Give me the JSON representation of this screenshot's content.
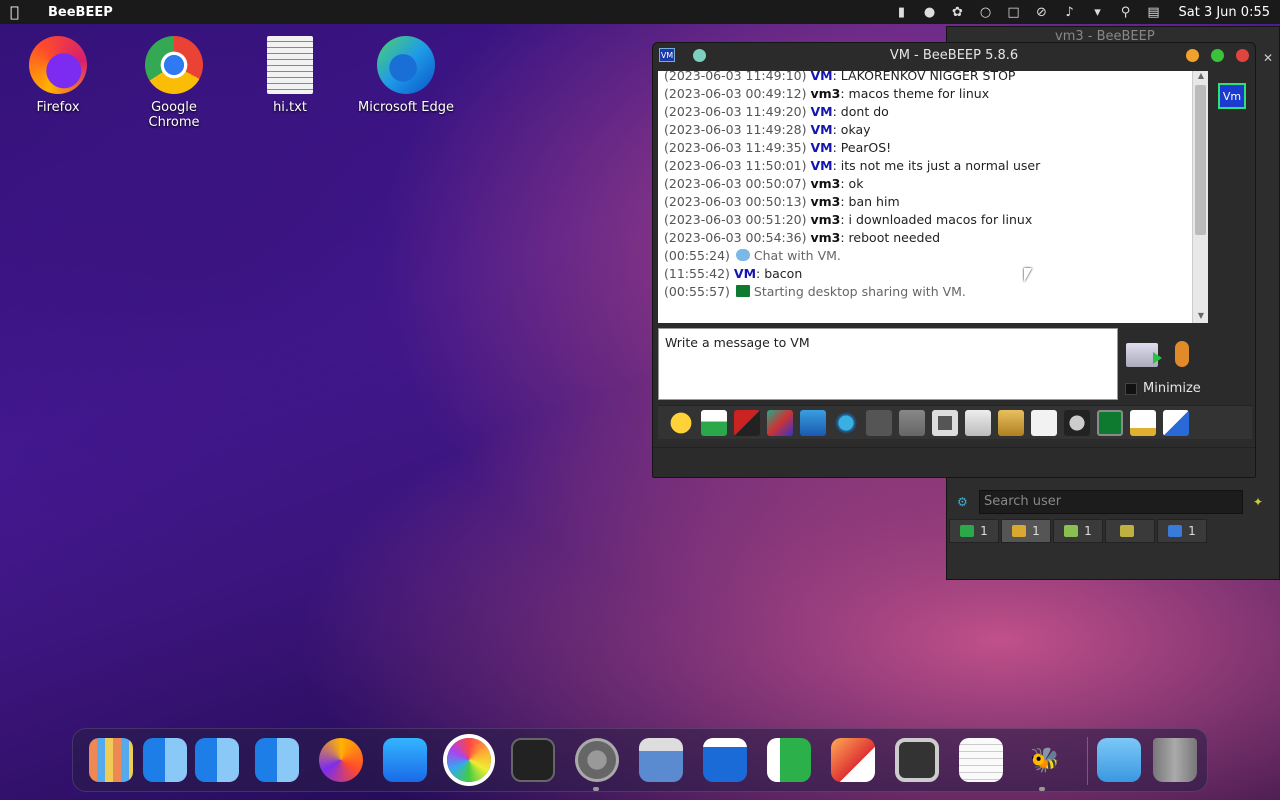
{
  "menubar": {
    "app_name": "BeeBEEP",
    "clock": "Sat 3 Jun 0:55",
    "tray_icons": [
      "battery-icon",
      "user-icon",
      "beebeep-tray-icon",
      "users-icon",
      "clipboard-icon",
      "mute-icon",
      "volume-icon",
      "dropdown-icon",
      "search-icon",
      "control-center-icon"
    ]
  },
  "desktop": {
    "icons": [
      {
        "label": "Firefox",
        "icon": "firefox-icon"
      },
      {
        "label": "Google Chrome",
        "icon": "chrome-icon"
      },
      {
        "label": "hi.txt",
        "icon": "text-file-icon"
      },
      {
        "label": "Microsoft Edge",
        "icon": "edge-icon"
      }
    ]
  },
  "chat_window": {
    "title": "VM - BeeBEEP 5.8.6",
    "badge": "VM",
    "user_badge": "Vm",
    "messages": [
      {
        "time": "(2023-06-03 11:49:10)",
        "user": "VM",
        "text": ": LAKORENKOV NIGGER STOP"
      },
      {
        "time": "(2023-06-03 00:49:12)",
        "user": "vm3",
        "text": ": macos theme for linux"
      },
      {
        "time": "(2023-06-03 11:49:20)",
        "user": "VM",
        "text": ": dont do"
      },
      {
        "time": "(2023-06-03 11:49:28)",
        "user": "VM",
        "text": ": okay"
      },
      {
        "time": "(2023-06-03 11:49:35)",
        "user": "VM",
        "text": ": PearOS!"
      },
      {
        "time": "(2023-06-03 11:50:01)",
        "user": "VM",
        "text": ": its not me its just a normal user"
      },
      {
        "time": "(2023-06-03 00:50:07)",
        "user": "vm3",
        "text": ": ok"
      },
      {
        "time": "(2023-06-03 00:50:13)",
        "user": "vm3",
        "text": ": ban him"
      },
      {
        "time": "(2023-06-03 00:51:20)",
        "user": "vm3",
        "text": ": i downloaded macos for linux"
      },
      {
        "time": "(2023-06-03 00:54:36)",
        "user": "vm3",
        "text": ": reboot needed"
      }
    ],
    "events": [
      {
        "time": "(00:55:24)",
        "text": "Chat with VM.",
        "icon": "chat-bubble-icon"
      },
      {
        "time": "(11:55:42)",
        "user": "VM",
        "text": ": bacon"
      },
      {
        "time": "(00:55:57)",
        "text": "Starting desktop sharing with VM.",
        "icon": "desktop-share-icon"
      }
    ],
    "input_placeholder": "Write a message to VM",
    "minimize_label": "Minimize",
    "toolbar_icons": [
      "emoticon-icon",
      "send-file-icon",
      "font-icon",
      "font-color-icon",
      "filter-icon",
      "settings-icon",
      "spellcheck-icon",
      "dictionary-icon",
      "note-icon",
      "save-icon",
      "export-icon",
      "html-icon",
      "screenshot-icon",
      "desktop-share-icon",
      "edit-icon",
      "detach-icon"
    ],
    "colors": {
      "vm_user": "#1515b0",
      "vm3_user": "#111111",
      "close": "#e0443e",
      "minimize": "#f0a32a",
      "maximize": "#3ac23a"
    }
  },
  "back_window": {
    "title": "vm3 - BeeBEEP",
    "search_placeholder": "Search user",
    "tabs": [
      {
        "icon": "users-tab-icon",
        "count": "1"
      },
      {
        "icon": "groups-tab-icon",
        "count": "1"
      },
      {
        "icon": "chats-tab-icon",
        "count": "1"
      },
      {
        "icon": "network-tab-icon",
        "count": ""
      },
      {
        "icon": "files-tab-icon",
        "count": "1"
      }
    ]
  },
  "dock": {
    "items": [
      "launchpad-icon",
      "finder-icon",
      "finder-icon",
      "finder-icon",
      "firefox-icon",
      "app-store-icon",
      "photos-icon",
      "terminal-icon",
      "system-preferences-icon",
      "screenshot-icon",
      "text-editor-icon",
      "spreadsheet-icon",
      "preview-icon",
      "cassette-icon",
      "notes-icon",
      "beebeep-icon",
      "downloads-folder-icon",
      "trash-icon"
    ]
  }
}
